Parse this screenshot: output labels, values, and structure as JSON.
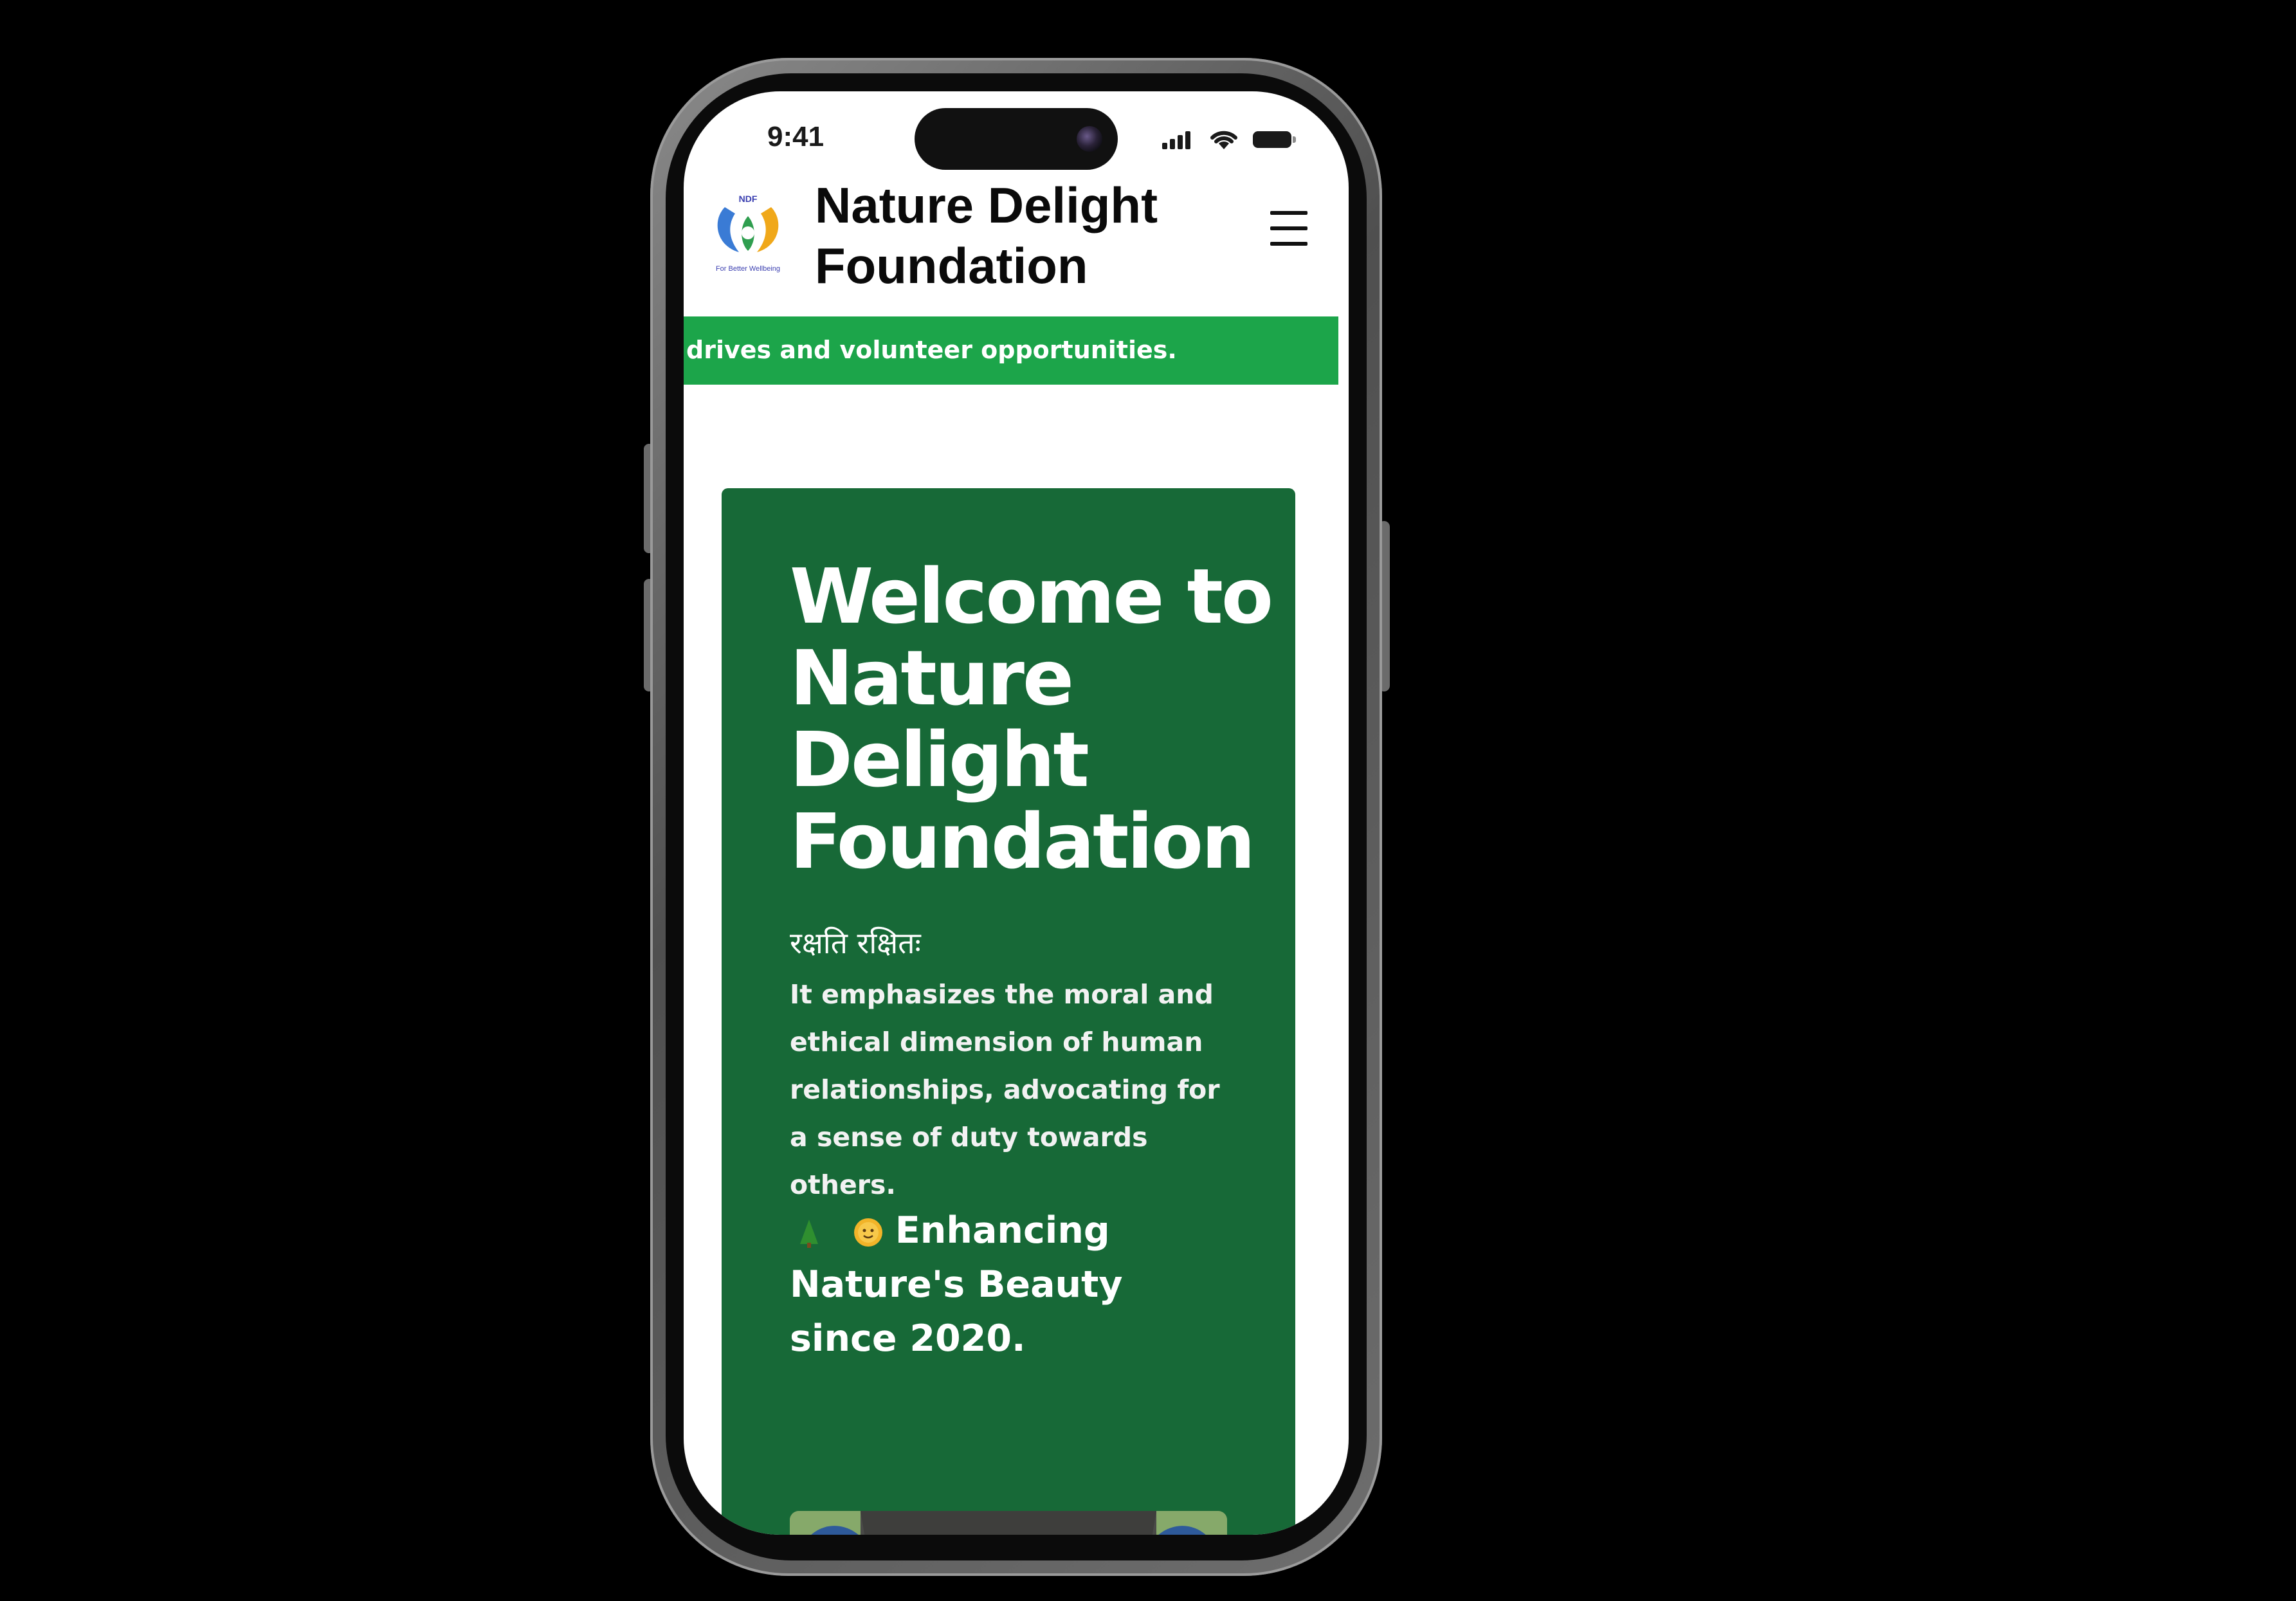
{
  "status_bar": {
    "time": "9:41"
  },
  "header": {
    "site_title": "Nature Delight Foundation",
    "logo_icon": "ndf-hands-logo-icon",
    "logo_caption": "For Better Wellbeing",
    "menu_icon": "hamburger-menu-icon"
  },
  "ticker": {
    "text": "drives and volunteer opportunities."
  },
  "hero": {
    "title": "Welcome to Nature Delight Foundation",
    "motto": "रक्षति रक्षितः",
    "description": "It emphasizes the moral and ethical dimension of human relationships, advocating for a sense of duty towards others.",
    "since_emoji_1": "tree-emoji-icon",
    "since_emoji_2": "sun-emoji-icon",
    "since_text": "Enhancing Nature's Beauty since 2020."
  },
  "colors": {
    "ticker_bg": "#1ca54a",
    "hero_bg": "#176937",
    "page_bg": "#000000"
  }
}
